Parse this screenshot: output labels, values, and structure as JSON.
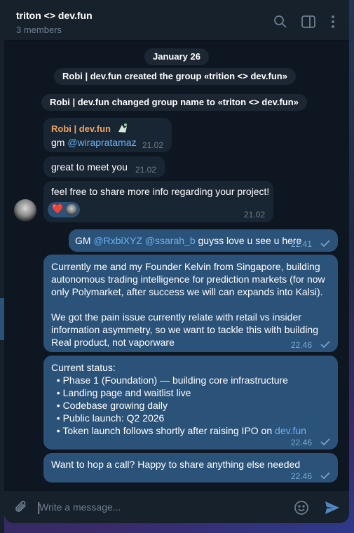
{
  "header": {
    "title": "triton <> dev.fun",
    "subtitle": "3 members"
  },
  "date_separator": "January 26",
  "service_messages": [
    "Robi | dev.fun created the group «trition <> dev.fun»",
    "Robi | dev.fun changed group name to «triton <> dev.fun»"
  ],
  "incoming": [
    {
      "sender": "Robi | dev.fun",
      "text_prefix": "gm ",
      "mention": "@wirapratamaz",
      "time": "21.02"
    },
    {
      "text": "great to meet you",
      "time": "21.02"
    },
    {
      "text": "feel free to share more info regarding your project!",
      "time": "21.02",
      "reaction": "❤️"
    }
  ],
  "outgoing": [
    {
      "mention1": "GM ",
      "mention2": "@RxbiXYZ",
      "mention3": "@ssarah_b",
      "rest": " guyss love u see u here",
      "time": "22.41"
    },
    {
      "lines": [
        "Currently me and my Founder Kelvin from Singapore, building",
        "autonomous trading intelligence for prediction markets (for now",
        "only Polymarket, after success we will can expands into Kalsi).",
        "",
        "We got the pain issue currently relate with retail vs insider",
        "information asymmetry, so we want to tackle this with building",
        "Real product, not vaporware"
      ],
      "time": "22.46"
    },
    {
      "lines": [
        "Current status:",
        "  • Phase 1 (Foundation) — building core infrastructure",
        "  • Landing page and waitlist live",
        "  • Codebase growing daily",
        "  • Public launch: Q2 2026"
      ],
      "last_line_prefix": "  • Token launch follows shortly after raising IPO on ",
      "last_line_link": "dev.fun",
      "time": "22.46"
    },
    {
      "text": "Want to hop a call? Happy to share anything else needed",
      "time": "22.46"
    }
  ],
  "composer": {
    "placeholder": "Write a message..."
  },
  "icons": {
    "search": "search-icon",
    "sidebar": "sidebar-toggle-icon",
    "more": "more-vertical-icon",
    "attach": "paperclip-icon",
    "emoji": "emoji-icon",
    "send": "send-icon",
    "read": "check-icon"
  },
  "colors": {
    "bg": "#0e1621",
    "panel": "#17212b",
    "incoming_bubble": "#182533",
    "outgoing_bubble": "#2b5278",
    "link": "#6ab3f3",
    "sender_name": "#f0a35e"
  }
}
